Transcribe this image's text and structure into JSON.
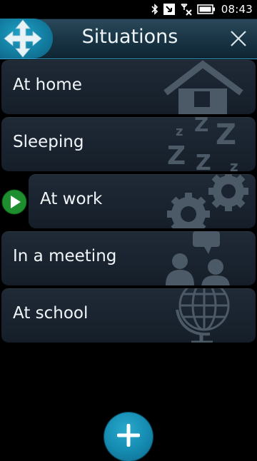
{
  "status_bar": {
    "time": "08:43",
    "icons": [
      "bluetooth-icon",
      "message-icon",
      "no-signal-icon",
      "battery-icon"
    ]
  },
  "header": {
    "title": "Situations",
    "app_icon": "move-arrows-icon",
    "close_icon": "close-icon"
  },
  "situations": [
    {
      "label": "At home",
      "icon": "house-icon",
      "active": false
    },
    {
      "label": "Sleeping",
      "icon": "sleep-zzz-icon",
      "active": false
    },
    {
      "label": "At work",
      "icon": "gears-icon",
      "active": true
    },
    {
      "label": "In a meeting",
      "icon": "people-speech-icon",
      "active": false
    },
    {
      "label": "At school",
      "icon": "globe-icon",
      "active": false
    }
  ],
  "fab": {
    "icon": "add-icon"
  },
  "colors": {
    "accent": "#1a9cc2",
    "active_marker": "#1e8f2e",
    "item_background": "#1c2632",
    "art_grey": "#4c5966"
  }
}
